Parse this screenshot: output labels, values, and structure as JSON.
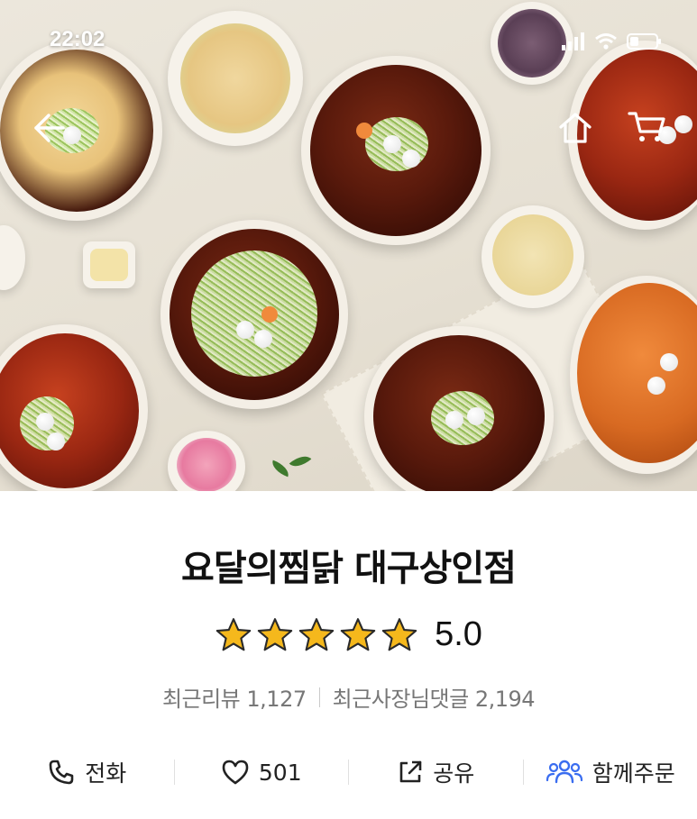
{
  "status_bar": {
    "time": "22:02"
  },
  "hero": {
    "description_icon_back": "back-arrow-icon"
  },
  "store": {
    "name": "요달의찜닭 대구상인점",
    "rating": "5.0",
    "rating_stars": 5,
    "recent_reviews_label": "최근리뷰",
    "recent_reviews_count": "1,127",
    "recent_replies_label": "최근사장님댓글",
    "recent_replies_count": "2,194"
  },
  "actions": {
    "call_label": "전화",
    "like_count": "501",
    "share_label": "공유",
    "group_order_label": "함께주문"
  },
  "colors": {
    "star": "#F5B81C",
    "accent_blue": "#3a6df0",
    "text_muted": "#777777"
  }
}
